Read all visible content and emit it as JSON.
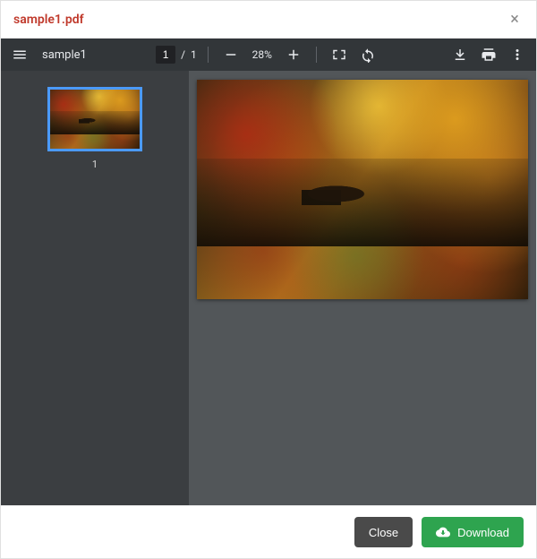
{
  "titlebar": {
    "filename": "sample1.pdf"
  },
  "toolbar": {
    "doc_name": "sample1",
    "page_current": "1",
    "page_sep": "/",
    "page_total": "1",
    "zoom_label": "28%"
  },
  "sidebar": {
    "thumbnails": [
      {
        "page_number": "1"
      }
    ]
  },
  "footer": {
    "close_label": "Close",
    "download_label": "Download"
  },
  "icons": {
    "menu": "menu-icon",
    "close_x": "close-icon",
    "zoom_out": "zoom-out-icon",
    "zoom_in": "zoom-in-icon",
    "fit": "fit-page-icon",
    "rotate": "rotate-icon",
    "download": "download-icon",
    "print": "print-icon",
    "more": "more-icon",
    "cloud_download": "cloud-download-icon"
  }
}
